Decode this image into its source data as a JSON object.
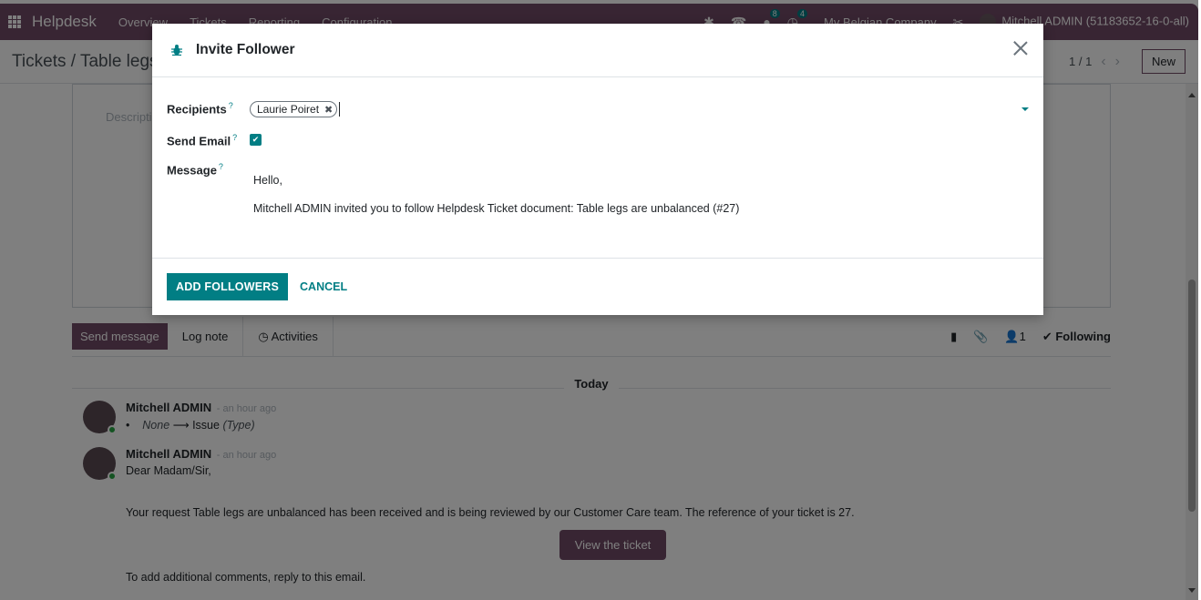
{
  "navbar": {
    "app_name": "Helpdesk",
    "menus": [
      "Overview",
      "Tickets",
      "Reporting",
      "Configuration"
    ],
    "icons": [
      "bug-icon",
      "phone-icon",
      "chat-icon",
      "clock-icon"
    ],
    "messages_badge": "8",
    "activities_badge": "4",
    "company": "My Belgian Company",
    "user": "Mitchell ADMIN (51183652-16-0-all)"
  },
  "control_panel": {
    "breadcrumb": "Tickets / Table legs",
    "pager": "1 / 1",
    "new_label": "New"
  },
  "form": {
    "description_placeholder": "Description"
  },
  "chatter": {
    "send_message": "Send message",
    "log_note": "Log note",
    "activities": "Activities",
    "followers_count": "1",
    "following": "Following",
    "date_separator": "Today",
    "messages": [
      {
        "author": "Mitchell ADMIN",
        "time": "- an hour ago",
        "old_value": "None",
        "new_value": "Issue",
        "field": "(Type)"
      },
      {
        "author": "Mitchell ADMIN",
        "time": "- an hour ago",
        "greeting": "Dear Madam/Sir,",
        "body": "Your request Table legs are unbalanced has been received and is being reviewed by our Customer Care team. The reference of your ticket is 27.",
        "button": "View the ticket",
        "footer": "To add additional comments, reply to this email."
      }
    ]
  },
  "modal": {
    "title": "Invite Follower",
    "fields": {
      "recipients_label": "Recipients",
      "send_email_label": "Send Email",
      "message_label": "Message",
      "help_mark": "?"
    },
    "recipients": [
      "Laurie Poiret"
    ],
    "send_email": true,
    "message_lines": [
      "Hello,",
      "Mitchell ADMIN invited you to follow Helpdesk Ticket document: Table legs are unbalanced (#27)"
    ],
    "add_followers": "ADD FOLLOWERS",
    "cancel": "CANCEL"
  },
  "colors": {
    "brand": "#714b67",
    "accent": "#017e84"
  }
}
